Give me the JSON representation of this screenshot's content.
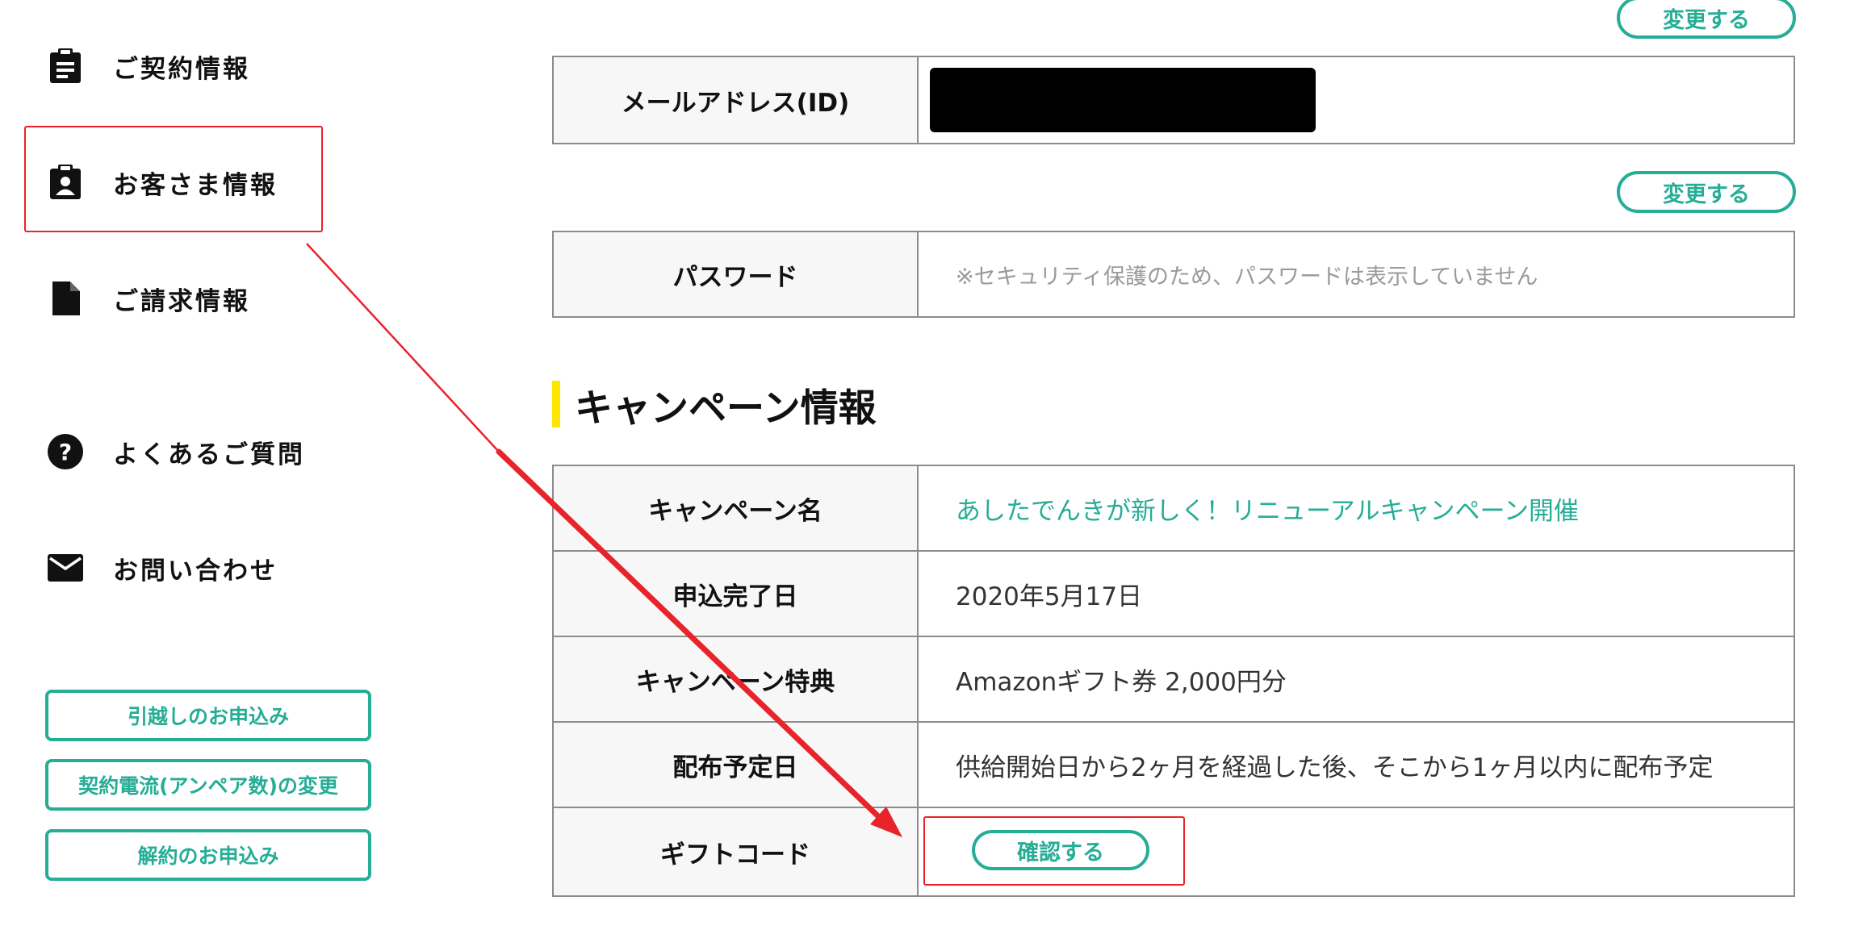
{
  "sidebar": {
    "items": [
      {
        "label": "ご契約情報",
        "icon": "clipboard-icon"
      },
      {
        "label": "お客さま情報",
        "icon": "id-badge-icon"
      },
      {
        "label": "ご請求情報",
        "icon": "document-icon"
      },
      {
        "label": "よくあるご質問",
        "icon": "question-circle-icon"
      },
      {
        "label": "お問い合わせ",
        "icon": "envelope-icon"
      }
    ],
    "buttons": [
      {
        "label": "引越しのお申込み"
      },
      {
        "label": "契約電流(アンペア数)の変更"
      },
      {
        "label": "解約のお申込み"
      }
    ]
  },
  "account": {
    "change_label": "変更する",
    "email_label": "メールアドレス(ID)",
    "email_value": "",
    "password_label": "パスワード",
    "password_note": "※セキュリティ保護のため、パスワードは表示していません"
  },
  "campaign": {
    "section_title": "キャンペーン情報",
    "rows": [
      {
        "label": "キャンペーン名",
        "value": "あしたでんきが新しく！リニューアルキャンペーン開催"
      },
      {
        "label": "申込完了日",
        "value": "2020年5月17日"
      },
      {
        "label": "キャンペーン特典",
        "value": "Amazonギフト券 2,000円分"
      },
      {
        "label": "配布予定日",
        "value": "供給開始日から2ヶ月を経過した後、そこから1ヶ月以内に配布予定"
      },
      {
        "label": "ギフトコード",
        "value": ""
      }
    ],
    "confirm_label": "確認する"
  },
  "colors": {
    "accent": "#26ad96",
    "section_bar": "#ffe600",
    "annotation": "#e8232a",
    "redacted": "#000000"
  }
}
